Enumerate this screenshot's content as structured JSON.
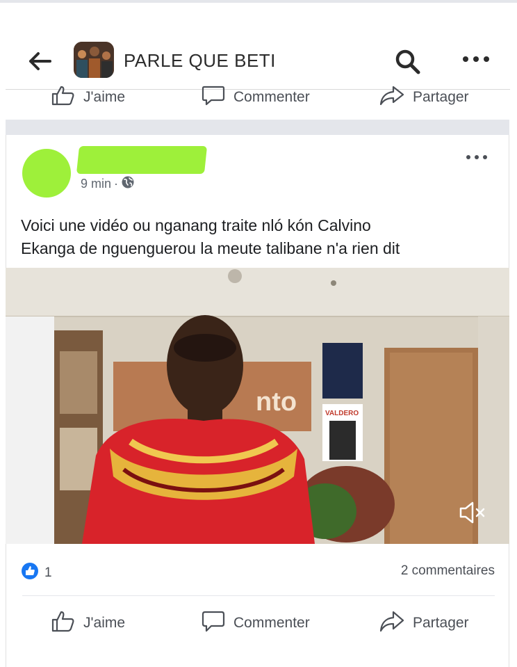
{
  "header": {
    "group_name": "PARLE QUE BETI",
    "icons": [
      "back-arrow-icon",
      "search-icon",
      "more-icon"
    ]
  },
  "previous_post_actions": {
    "like": "J'aime",
    "comment": "Commenter",
    "share": "Partager"
  },
  "post": {
    "time": "9 min",
    "separator": "·",
    "text_line1": "Voici une vidéo ou nganang traite nló kón Calvino",
    "text_line2": "Ekanga de nguenguerou la meute talibane n'a rien dit",
    "video": {
      "muted": true,
      "sign_text": "nto",
      "poster_text": "VALDERO"
    },
    "reactions_count": "1",
    "comments_count": "2 commentaires",
    "actions": {
      "like": "J'aime",
      "comment": "Commenter",
      "share": "Partager"
    }
  },
  "colors": {
    "redaction": "#9ef03a",
    "like_blue": "#1877f2",
    "text": "#1c1e21",
    "muted_text": "#4b4f56"
  }
}
